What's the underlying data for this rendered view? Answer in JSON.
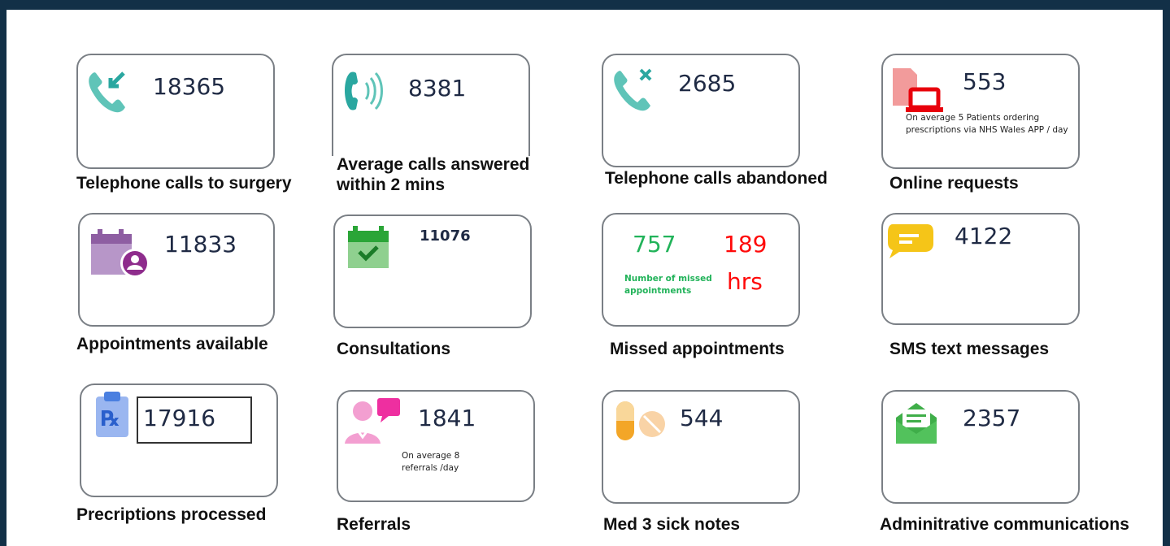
{
  "cards": {
    "calls_to_surgery": {
      "value": "18365",
      "caption": "Telephone calls to surgery"
    },
    "calls_answered": {
      "value": "8381",
      "caption": "Average calls answered within 2 mins"
    },
    "calls_abandoned": {
      "value": "2685",
      "caption": "Telephone calls abandoned"
    },
    "online_requests": {
      "value": "553",
      "note": "On average 5 Patients ordering prescriptions via NHS Wales APP / day",
      "caption": "Online requests"
    },
    "appointments": {
      "value": "11833",
      "caption": "Appointments available"
    },
    "consultations": {
      "value": "11076",
      "caption": "Consultations"
    },
    "missed": {
      "value_count": "757",
      "value_hours": "189",
      "hours_unit": "hrs",
      "note": "Number of missed appointments",
      "caption": "Missed appointments"
    },
    "sms": {
      "value": "4122",
      "caption": "SMS text messages"
    },
    "prescriptions": {
      "value": "17916",
      "caption": "Precriptions processed"
    },
    "referrals": {
      "value": "1841",
      "note": "On average 8 referrals /day",
      "caption": "Referrals"
    },
    "sick_notes": {
      "value": "544",
      "caption": "Med 3 sick notes"
    },
    "admin_comms": {
      "value": "2357",
      "caption": "Adminitrative communications"
    }
  },
  "icons": {
    "phone_incoming": "phone-incoming-icon",
    "phone_ringing": "phone-ringing-icon",
    "phone_missed": "phone-missed-icon",
    "online": "laptop-document-icon",
    "calendar_user": "calendar-user-icon",
    "calendar_check": "calendar-check-icon",
    "chat": "chat-bubble-icon",
    "clipboard_rx": "clipboard-rx-icon",
    "doctor_chat": "doctor-chat-icon",
    "pills": "pills-icon",
    "envelope": "open-envelope-icon"
  },
  "colors": {
    "teal": "#5fc4b8",
    "green_count": "#22b35a",
    "red_hours": "#ff0a0a",
    "purple": "#8e5ea2",
    "calendar_green": "#3cb54a",
    "chat_yellow": "#f5c518",
    "rx_blue": "#4a7fe0",
    "pink": "#ee5fb5",
    "pill_orange": "#f3a627",
    "envelope_green": "#3fae49"
  }
}
